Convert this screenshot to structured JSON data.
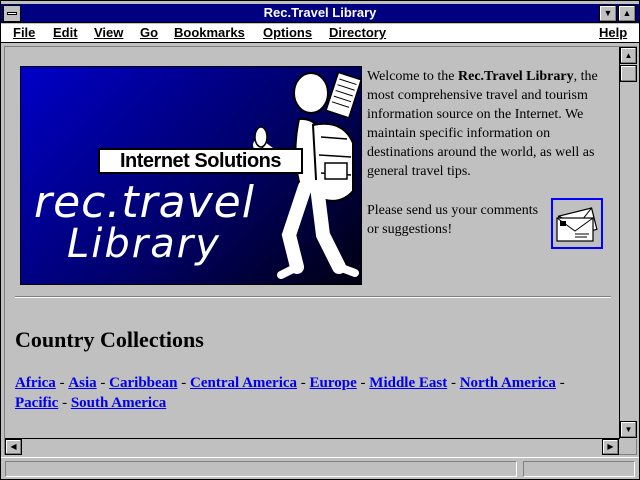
{
  "window": {
    "title": "Rec.Travel Library"
  },
  "menu": {
    "file": "File",
    "edit": "Edit",
    "view": "View",
    "go": "Go",
    "bookmarks": "Bookmarks",
    "options": "Options",
    "directory": "Directory",
    "help": "Help"
  },
  "banner": {
    "box_text": "Internet Solutions",
    "line1": "rec.travel",
    "line2": "Library"
  },
  "intro": {
    "prefix": "Welcome to the ",
    "name": "Rec.Travel Library",
    "suffix": ", the most comprehensive travel and tourism information source on the Internet. We maintain specific information on destinations around the world, as well as general travel tips."
  },
  "send": {
    "text": "Please send us your comments or suggestions!"
  },
  "section": {
    "heading": "Country Collections"
  },
  "links": {
    "separator": " - ",
    "items": [
      "Africa",
      "Asia",
      "Caribbean",
      "Central America",
      "Europe",
      "Middle East",
      "North America",
      "Pacific",
      "South America"
    ]
  },
  "colors": {
    "titlebar": "#000080",
    "link": "#0000ee",
    "face": "#c0c0c0"
  }
}
